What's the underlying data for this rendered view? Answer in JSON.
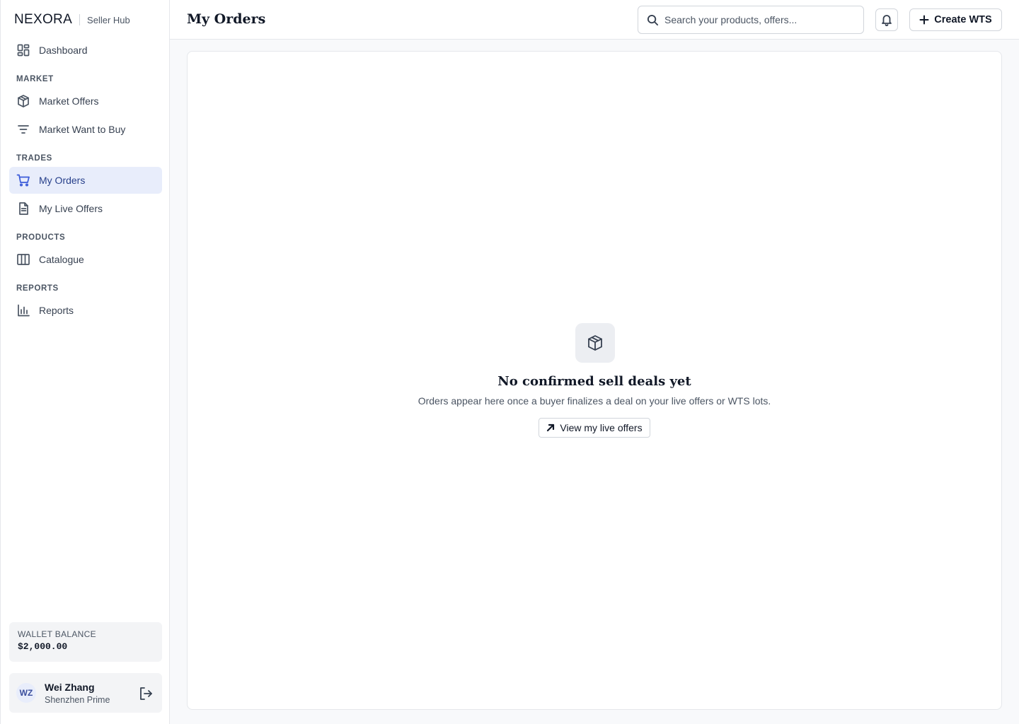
{
  "brand": {
    "logo": "NEXORA",
    "subtitle": "Seller Hub"
  },
  "sidebar": {
    "dashboard": {
      "label": "Dashboard",
      "icon": "dashboard-icon"
    },
    "sections": {
      "market": "MARKET",
      "trades": "TRADES",
      "products": "PRODUCTS",
      "reports": "REPORTS"
    },
    "items": {
      "market_offers": {
        "label": "Market Offers",
        "icon": "box-icon"
      },
      "market_wtb": {
        "label": "Market Want to Buy",
        "icon": "filter-icon"
      },
      "my_orders": {
        "label": "My Orders",
        "icon": "cart-icon",
        "active": true
      },
      "my_live_offers": {
        "label": "My Live Offers",
        "icon": "document-icon"
      },
      "catalogue": {
        "label": "Catalogue",
        "icon": "columns-icon"
      },
      "reports": {
        "label": "Reports",
        "icon": "bar-chart-icon"
      }
    },
    "wallet": {
      "label": "WALLET BALANCE",
      "amount": "$2,000.00"
    },
    "user": {
      "initials": "WZ",
      "name": "Wei Zhang",
      "org": "Shenzhen Prime"
    }
  },
  "header": {
    "title": "My Orders",
    "search_placeholder": "Search your products, offers...",
    "create_label": "Create WTS"
  },
  "empty_state": {
    "title": "No confirmed sell deals yet",
    "description": "Orders appear here once a buyer finalizes a deal on your live offers or WTS lots.",
    "button_label": "View my live offers"
  },
  "colors": {
    "accent": "#3b5bd9",
    "active_bg": "#e8edfb",
    "active_text": "#27408b"
  }
}
